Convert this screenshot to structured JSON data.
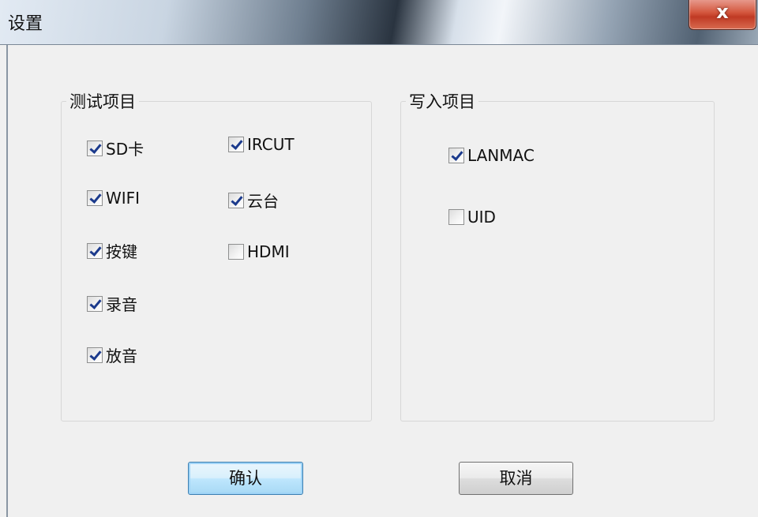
{
  "window": {
    "title": "设置",
    "close_glyph": "x"
  },
  "test_group": {
    "legend": "测试项目",
    "items": [
      {
        "label": "SD卡",
        "checked": true
      },
      {
        "label": "WIFI",
        "checked": true
      },
      {
        "label": "按键",
        "checked": true
      },
      {
        "label": "录音",
        "checked": true
      },
      {
        "label": "放音",
        "checked": true
      },
      {
        "label": "IRCUT",
        "checked": true
      },
      {
        "label": "云台",
        "checked": true
      },
      {
        "label": "HDMI",
        "checked": false
      }
    ]
  },
  "write_group": {
    "legend": "写入项目",
    "items": [
      {
        "label": "LANMAC",
        "checked": true
      },
      {
        "label": "UID",
        "checked": false
      }
    ]
  },
  "buttons": {
    "confirm": "确认",
    "cancel": "取消"
  },
  "colors": {
    "checkmark": "#1b3a8c",
    "close_button": "#c03a24",
    "default_button_border": "#3c7fb1"
  }
}
